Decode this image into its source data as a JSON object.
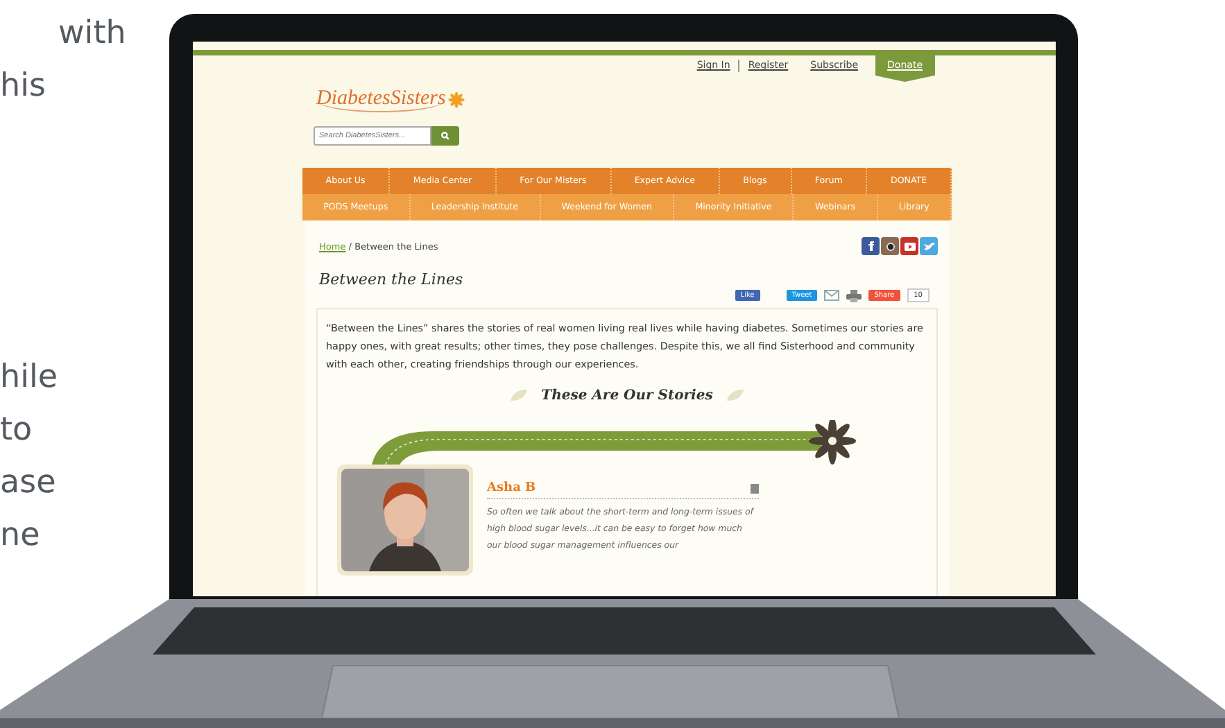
{
  "side_text": {
    "paragraphs": [
      [
        "with",
        "his"
      ],
      [
        "hile",
        "to",
        "ase",
        "ne"
      ]
    ]
  },
  "site": {
    "top_links": [
      "Sign In",
      "Register",
      "Subscribe"
    ],
    "donate_tab": "Donate",
    "logo": "DiabetesSisters",
    "search": {
      "placeholder": "Search DiabetesSisters..."
    },
    "nav_rows": [
      [
        "About Us",
        "Media Center",
        "For Our Misters",
        "Expert Advice",
        "Blogs",
        "Forum",
        "DONATE"
      ],
      [
        "PODS Meetups",
        "Leadership Institute",
        "Weekend for Women",
        "Minority Initiative",
        "Webinars",
        "Library"
      ]
    ],
    "breadcrumb": {
      "link": "Home",
      "separator": "/",
      "current": "Between the Lines"
    },
    "page_title": "Between the Lines",
    "share_bar": {
      "like": "Like",
      "tweet": "Tweet",
      "share": "Share",
      "count": "10"
    },
    "intro": "“Between the Lines” shares the stories of real women living real lives while having diabetes. Sometimes our stories are happy ones, with great results; other times, they pose challenges. Despite this, we all find Sisterhood and community with each other, creating friendships through our experiences.",
    "section_title": "These Are Our Stories",
    "stories": [
      {
        "name": "Asha B",
        "excerpt": "So often we talk about the short-term and long-term issues of high blood sugar levels...it can be easy to forget how much our blood sugar management influences our"
      }
    ]
  }
}
